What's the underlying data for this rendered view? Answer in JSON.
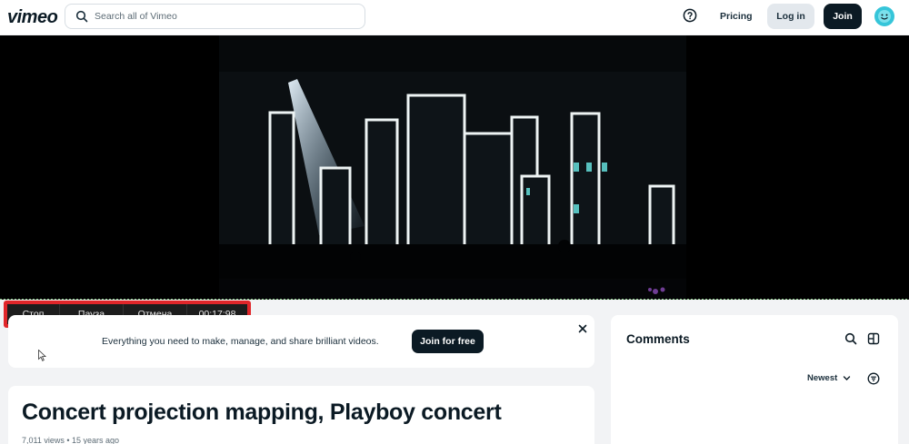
{
  "header": {
    "logo": "vimeo",
    "search_placeholder": "Search all of Vimeo",
    "pricing_label": "Pricing",
    "login_label": "Log in",
    "join_label": "Join"
  },
  "recorder": {
    "stop_label": "Стоп",
    "pause_label": "Пауза",
    "cancel_label": "Отмена",
    "elapsed": "00:17:98",
    "border_color": "#e0262a"
  },
  "promo": {
    "text": "Everything you need to make, manage, and share brilliant videos.",
    "cta_label": "Join for free"
  },
  "video": {
    "title": "Concert projection mapping, Playboy concert",
    "meta": "7,011 views • 15 years ago"
  },
  "comments": {
    "title": "Comments",
    "sort_label": "Newest"
  },
  "colors": {
    "brand_dark": "#0b1a24",
    "avatar": "#36c5d9"
  }
}
